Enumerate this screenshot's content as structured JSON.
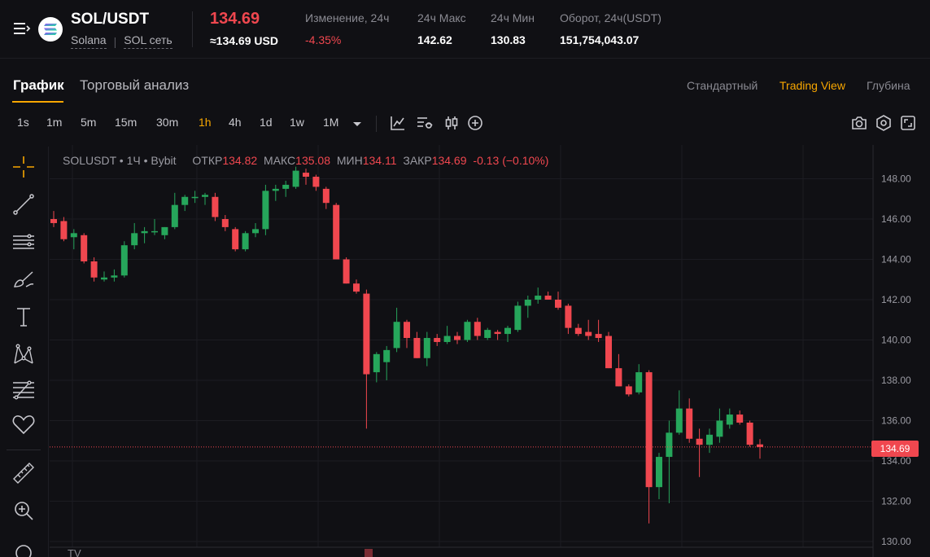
{
  "header": {
    "symbol": "SOL/USDT",
    "network_name": "Solana",
    "network_link": "SOL сеть",
    "last_price": "134.69",
    "last_price_usd": "≈134.69 USD",
    "stats": [
      {
        "label": "Изменение, 24ч",
        "value": "-4.35%"
      },
      {
        "label": "24ч Макс",
        "value": "142.62"
      },
      {
        "label": "24ч Мин",
        "value": "130.83"
      },
      {
        "label": "Оборот, 24ч(USDT)",
        "value": "151,754,043.07"
      }
    ]
  },
  "tabs": [
    {
      "label": "График"
    },
    {
      "label": "Торговый анализ"
    }
  ],
  "views": [
    {
      "label": "Стандартный"
    },
    {
      "label": "Trading View"
    },
    {
      "label": "Глубина"
    }
  ],
  "timeframes": [
    "1s",
    "1m",
    "5m",
    "15m",
    "30m",
    "1h",
    "4h",
    "1d",
    "1w",
    "1M"
  ],
  "active_timeframe": "1h",
  "legend": {
    "symbol": "SOLUSDT",
    "interval": "1Ч",
    "exchange": "Bybit",
    "open_label": "ОТКР",
    "open": "134.82",
    "high_label": "МАКС",
    "high": "135.08",
    "low_label": "МИН",
    "low": "134.11",
    "close_label": "ЗАКР",
    "close": "134.69",
    "change": "-0.13 (−0.10%)"
  },
  "current_price_tag": "134.69",
  "colors": {
    "up": "#26a65b",
    "down": "#f0474f",
    "accent": "#f7a600",
    "background": "#101014"
  },
  "icons": {
    "menu": "menu-icon",
    "logo": "solana-logo",
    "tools": [
      "crosshair-icon",
      "trendline-icon",
      "horizontal-lines-icon",
      "brush-icon",
      "text-icon",
      "pattern-icon",
      "fib-icon",
      "favorite-icon",
      "ruler-icon",
      "zoom-icon"
    ],
    "toolbar": [
      "indicators-icon",
      "chart-type-icon",
      "candles-icon",
      "add-icon",
      "camera-icon",
      "settings-icon",
      "fullscreen-icon"
    ]
  },
  "chart_data": {
    "type": "candlestick",
    "symbol": "SOLUSDT",
    "interval": "1h",
    "ylim": [
      130,
      148.8
    ],
    "y_ticks": [
      "148.00",
      "146.00",
      "144.00",
      "142.00",
      "140.00",
      "138.00",
      "136.00",
      "134.00",
      "132.00",
      "130.00"
    ],
    "current_price": 134.69,
    "grid": true,
    "candles": [
      {
        "o": 146.0,
        "h": 146.4,
        "l": 145.6,
        "c": 145.8
      },
      {
        "o": 145.9,
        "h": 146.1,
        "l": 144.9,
        "c": 145.0
      },
      {
        "o": 145.1,
        "h": 145.5,
        "l": 144.5,
        "c": 145.3
      },
      {
        "o": 145.2,
        "h": 145.3,
        "l": 143.8,
        "c": 143.9
      },
      {
        "o": 143.9,
        "h": 144.1,
        "l": 142.9,
        "c": 143.1
      },
      {
        "o": 143.0,
        "h": 143.4,
        "l": 142.9,
        "c": 143.1
      },
      {
        "o": 143.1,
        "h": 143.5,
        "l": 142.9,
        "c": 143.2
      },
      {
        "o": 143.2,
        "h": 144.9,
        "l": 143.1,
        "c": 144.7
      },
      {
        "o": 144.7,
        "h": 145.8,
        "l": 144.5,
        "c": 145.3
      },
      {
        "o": 145.3,
        "h": 145.6,
        "l": 144.8,
        "c": 145.4
      },
      {
        "o": 145.4,
        "h": 146.0,
        "l": 145.2,
        "c": 145.4
      },
      {
        "o": 145.2,
        "h": 145.6,
        "l": 145.0,
        "c": 145.6
      },
      {
        "o": 145.6,
        "h": 147.3,
        "l": 145.5,
        "c": 146.7
      },
      {
        "o": 146.7,
        "h": 147.2,
        "l": 146.4,
        "c": 147.1
      },
      {
        "o": 147.1,
        "h": 147.4,
        "l": 146.8,
        "c": 147.1
      },
      {
        "o": 147.1,
        "h": 147.3,
        "l": 146.7,
        "c": 147.2
      },
      {
        "o": 147.1,
        "h": 147.3,
        "l": 145.9,
        "c": 146.1
      },
      {
        "o": 146.0,
        "h": 146.2,
        "l": 145.4,
        "c": 145.6
      },
      {
        "o": 145.5,
        "h": 145.6,
        "l": 144.4,
        "c": 144.5
      },
      {
        "o": 144.5,
        "h": 145.4,
        "l": 144.4,
        "c": 145.3
      },
      {
        "o": 145.3,
        "h": 145.8,
        "l": 145.1,
        "c": 145.5
      },
      {
        "o": 145.5,
        "h": 147.7,
        "l": 145.2,
        "c": 147.4
      },
      {
        "o": 147.4,
        "h": 147.7,
        "l": 146.9,
        "c": 147.5
      },
      {
        "o": 147.5,
        "h": 147.9,
        "l": 147.1,
        "c": 147.7
      },
      {
        "o": 147.6,
        "h": 148.6,
        "l": 147.5,
        "c": 148.4
      },
      {
        "o": 148.3,
        "h": 148.5,
        "l": 147.7,
        "c": 148.1
      },
      {
        "o": 148.1,
        "h": 148.2,
        "l": 147.4,
        "c": 147.6
      },
      {
        "o": 147.5,
        "h": 147.6,
        "l": 146.5,
        "c": 146.8
      },
      {
        "o": 146.7,
        "h": 146.8,
        "l": 144.0,
        "c": 144.0
      },
      {
        "o": 144.0,
        "h": 144.1,
        "l": 142.8,
        "c": 142.8
      },
      {
        "o": 142.8,
        "h": 143.0,
        "l": 142.3,
        "c": 142.4
      },
      {
        "o": 142.3,
        "h": 142.5,
        "l": 135.6,
        "c": 138.3
      },
      {
        "o": 138.4,
        "h": 139.4,
        "l": 137.9,
        "c": 139.3
      },
      {
        "o": 138.9,
        "h": 139.7,
        "l": 138.0,
        "c": 139.5
      },
      {
        "o": 139.6,
        "h": 141.6,
        "l": 139.4,
        "c": 140.9
      },
      {
        "o": 140.9,
        "h": 141.0,
        "l": 139.6,
        "c": 140.1
      },
      {
        "o": 140.1,
        "h": 140.4,
        "l": 139.1,
        "c": 139.1
      },
      {
        "o": 139.1,
        "h": 140.4,
        "l": 138.7,
        "c": 140.1
      },
      {
        "o": 140.1,
        "h": 140.3,
        "l": 139.7,
        "c": 139.9
      },
      {
        "o": 139.9,
        "h": 140.7,
        "l": 139.8,
        "c": 140.2
      },
      {
        "o": 140.2,
        "h": 140.4,
        "l": 139.8,
        "c": 140.0
      },
      {
        "o": 140.0,
        "h": 141.0,
        "l": 139.9,
        "c": 140.9
      },
      {
        "o": 140.9,
        "h": 141.1,
        "l": 140.0,
        "c": 140.2
      },
      {
        "o": 140.1,
        "h": 140.6,
        "l": 140.0,
        "c": 140.5
      },
      {
        "o": 140.4,
        "h": 140.5,
        "l": 140.0,
        "c": 140.3
      },
      {
        "o": 140.3,
        "h": 140.7,
        "l": 139.9,
        "c": 140.6
      },
      {
        "o": 140.5,
        "h": 141.9,
        "l": 140.4,
        "c": 141.7
      },
      {
        "o": 141.7,
        "h": 142.2,
        "l": 141.1,
        "c": 142.0
      },
      {
        "o": 142.0,
        "h": 142.6,
        "l": 141.8,
        "c": 142.2
      },
      {
        "o": 142.2,
        "h": 142.4,
        "l": 142.0,
        "c": 142.0
      },
      {
        "o": 142.0,
        "h": 142.4,
        "l": 141.5,
        "c": 141.6
      },
      {
        "o": 141.7,
        "h": 141.8,
        "l": 140.3,
        "c": 140.6
      },
      {
        "o": 140.6,
        "h": 140.8,
        "l": 140.2,
        "c": 140.3
      },
      {
        "o": 140.4,
        "h": 141.0,
        "l": 140.0,
        "c": 140.2
      },
      {
        "o": 140.3,
        "h": 141.0,
        "l": 139.9,
        "c": 140.1
      },
      {
        "o": 140.2,
        "h": 140.4,
        "l": 138.6,
        "c": 138.6
      },
      {
        "o": 138.6,
        "h": 139.3,
        "l": 137.7,
        "c": 137.7
      },
      {
        "o": 137.7,
        "h": 137.8,
        "l": 137.2,
        "c": 137.3
      },
      {
        "o": 137.4,
        "h": 138.8,
        "l": 137.3,
        "c": 138.4
      },
      {
        "o": 138.4,
        "h": 138.5,
        "l": 130.9,
        "c": 132.7
      },
      {
        "o": 132.7,
        "h": 134.4,
        "l": 132.1,
        "c": 134.2
      },
      {
        "o": 134.2,
        "h": 136.0,
        "l": 131.9,
        "c": 135.4
      },
      {
        "o": 135.4,
        "h": 137.5,
        "l": 135.3,
        "c": 136.6
      },
      {
        "o": 136.6,
        "h": 137.1,
        "l": 134.9,
        "c": 135.1
      },
      {
        "o": 135.1,
        "h": 135.6,
        "l": 133.2,
        "c": 134.8
      },
      {
        "o": 134.8,
        "h": 135.6,
        "l": 134.4,
        "c": 135.3
      },
      {
        "o": 135.2,
        "h": 136.6,
        "l": 134.9,
        "c": 136.0
      },
      {
        "o": 135.8,
        "h": 136.6,
        "l": 135.6,
        "c": 136.3
      },
      {
        "o": 136.3,
        "h": 136.5,
        "l": 135.8,
        "c": 135.9
      },
      {
        "o": 135.9,
        "h": 136.0,
        "l": 134.7,
        "c": 134.8
      },
      {
        "o": 134.82,
        "h": 135.08,
        "l": 134.11,
        "c": 134.69
      }
    ]
  }
}
